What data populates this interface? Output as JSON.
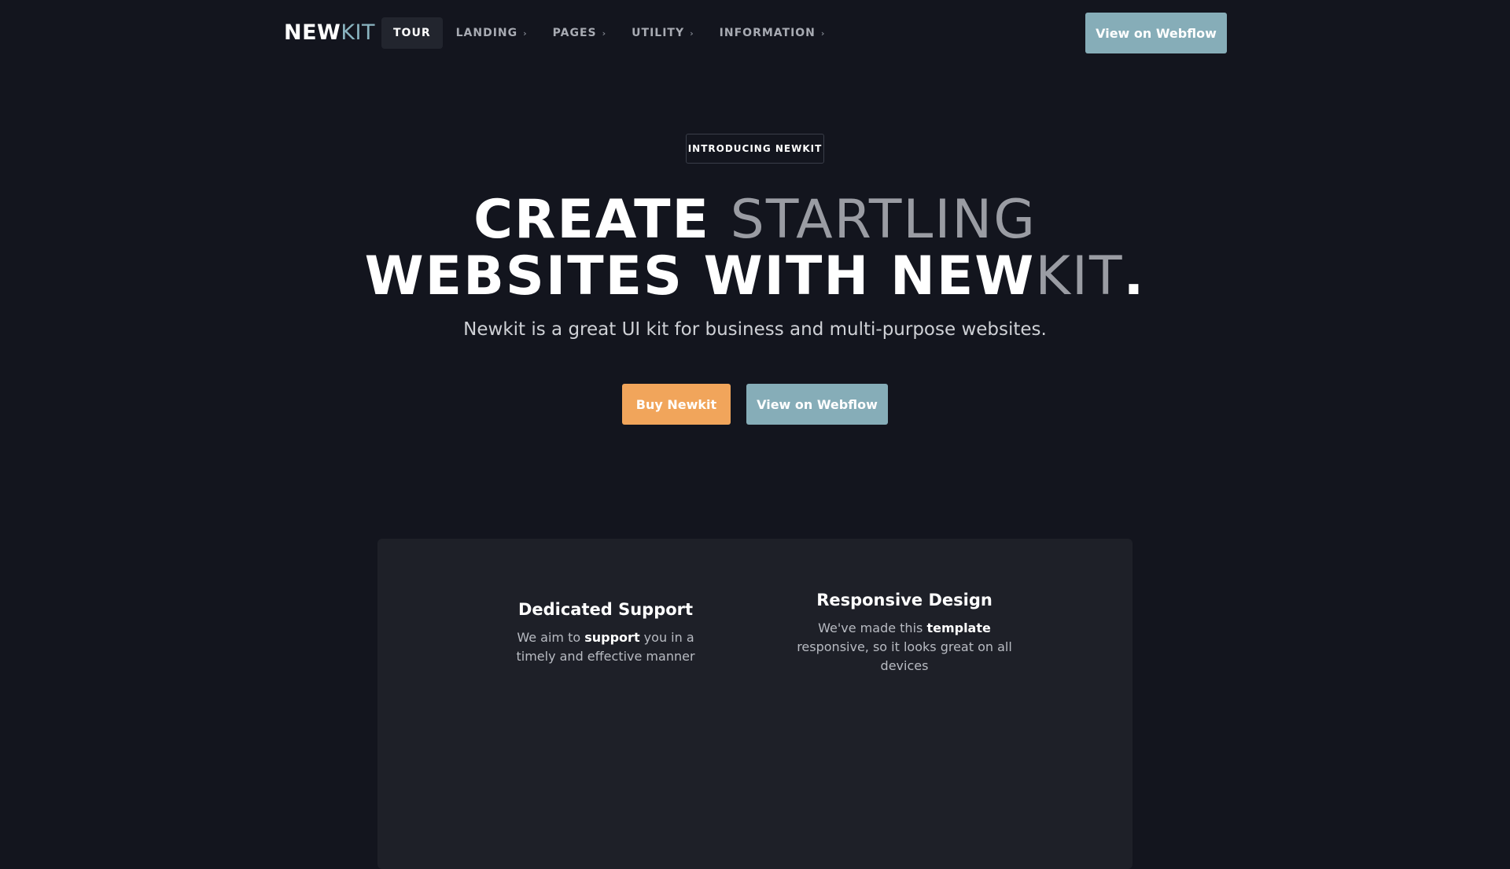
{
  "header": {
    "logo": {
      "part1": "NEW",
      "part2": "KIT"
    },
    "nav": [
      {
        "label": "TOUR",
        "active": true,
        "has_chevron": false
      },
      {
        "label": "LANDING",
        "active": false,
        "has_chevron": true
      },
      {
        "label": "PAGES",
        "active": false,
        "has_chevron": true
      },
      {
        "label": "UTILITY",
        "active": false,
        "has_chevron": true
      },
      {
        "label": "INFORMATION",
        "active": false,
        "has_chevron": true
      }
    ],
    "cta_label": "View on Webflow",
    "chevron_icon": "chevron-right-icon"
  },
  "hero": {
    "badge": "INTRODUCING NEWKIT",
    "headline": {
      "w1": "CREATE",
      "w2": "STARTLING",
      "w3": "WEBSITES WITH NEW",
      "w4": "KIT",
      "w5": "."
    },
    "subheadline": "Newkit is a great UI kit for business and multi-purpose websites.",
    "buy_label": "Buy Newkit",
    "webflow_label": "View on Webflow"
  },
  "features": [
    {
      "title": "Dedicated Support",
      "text_before": "We aim to ",
      "text_bold": "support",
      "text_after": " you in a timely and effective manner"
    },
    {
      "title": "Responsive Design",
      "text_before": "We've made this ",
      "text_bold": "template",
      "text_after": " responsive, so it looks great on all devices"
    }
  ],
  "colors": {
    "background": "#13151e",
    "panel": "#1e2028",
    "accent_teal": "#86adb8",
    "accent_orange": "#f1a55b"
  }
}
